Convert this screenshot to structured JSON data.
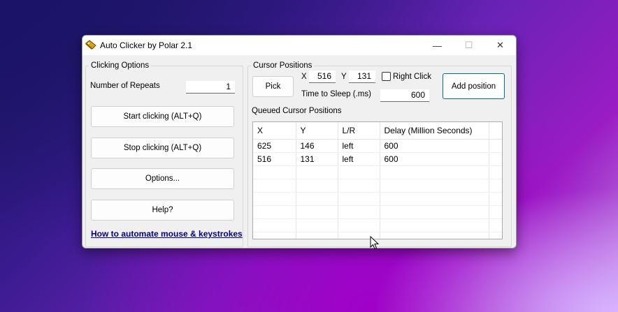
{
  "window": {
    "title": "Auto Clicker by Polar 2.1",
    "controls": {
      "minimize": "—",
      "maximize": "☐",
      "close": "✕"
    }
  },
  "clicking_options": {
    "legend": "Clicking Options",
    "repeats_label": "Number of Repeats",
    "repeats_value": "1",
    "start_button": "Start clicking (ALT+Q)",
    "stop_button": "Stop clicking (ALT+Q)",
    "options_button": "Options...",
    "help_button": "Help?",
    "automate_link": "How to automate mouse & keystrokes"
  },
  "cursor_positions": {
    "legend": "Cursor Positions",
    "pick_button": "Pick",
    "x_label": "X",
    "x_value": "516",
    "y_label": "Y",
    "y_value": "131",
    "right_click_label": "Right Click",
    "right_click_checked": false,
    "sleep_label": "Time to Sleep (.ms)",
    "sleep_value": "600",
    "add_button": "Add position",
    "queue_label": "Queued Cursor Positions",
    "columns": [
      "X",
      "Y",
      "L/R",
      "Delay (Million Seconds)",
      ""
    ],
    "rows": [
      [
        "625",
        "146",
        "left",
        "600",
        ""
      ],
      [
        "516",
        "131",
        "left",
        "600",
        ""
      ]
    ]
  },
  "icons": [
    "app-icon",
    "minimize-icon",
    "maximize-icon",
    "close-icon",
    "mouse-cursor-icon"
  ],
  "colors": {
    "link": "#00008b",
    "default_button_border": "#0067c0"
  }
}
